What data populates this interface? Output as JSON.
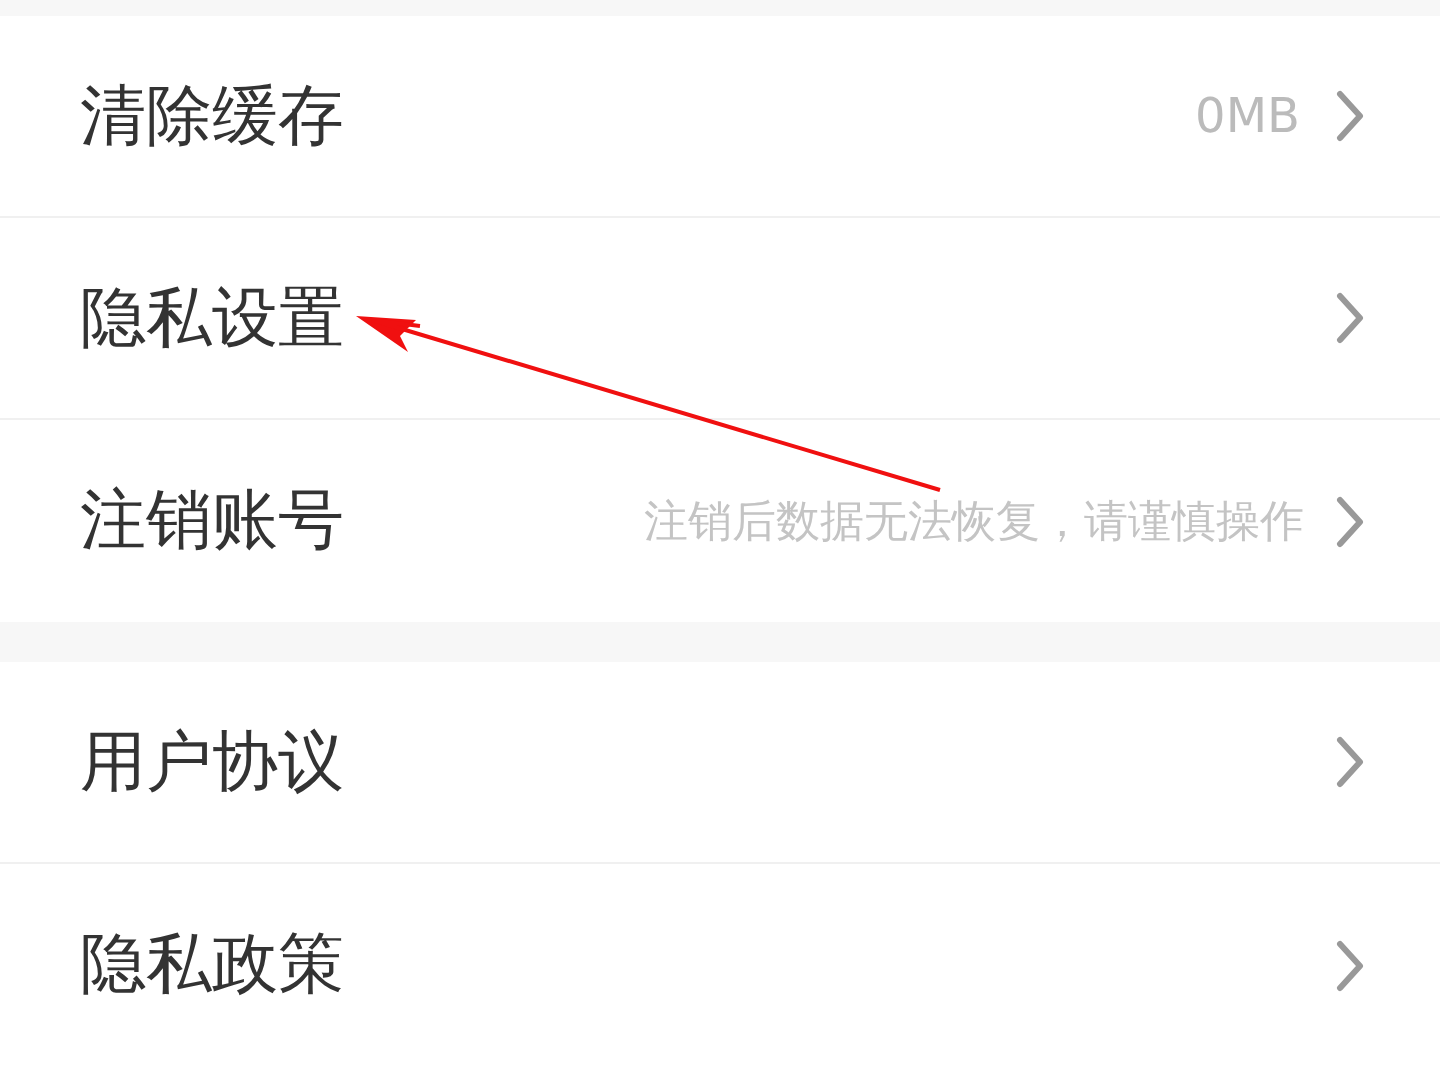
{
  "groups": [
    {
      "items": [
        {
          "label": "清除缓存",
          "value": "0MB"
        },
        {
          "label": "隐私设置"
        },
        {
          "label": "注销账号",
          "hint": "注销后数据无法恢复，请谨慎操作"
        }
      ]
    },
    {
      "items": [
        {
          "label": "用户协议"
        },
        {
          "label": "隐私政策"
        }
      ]
    }
  ]
}
